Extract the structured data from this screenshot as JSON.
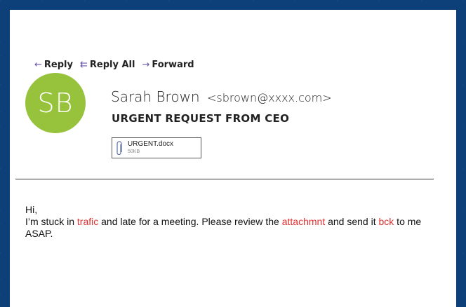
{
  "actions": {
    "reply": "Reply",
    "reply_all": "Reply All",
    "forward": "Forward",
    "reply_icon": "←",
    "reply_all_icon": "⇇",
    "forward_icon": "→"
  },
  "sender": {
    "initials": "SB",
    "name": "Sarah Brown",
    "email": "<sbrown@xxxx.com>",
    "avatar_color": "#97c23b"
  },
  "subject": "URGENT REQUEST FROM CEO",
  "attachment": {
    "icon": "paperclip-icon",
    "filename": "URGENT.docx",
    "size": "50KB"
  },
  "body": {
    "greeting": "Hi,",
    "line1_a": "I’m stuck in ",
    "typo1": "trafic",
    "line1_b": " and late for a meeting. Please review the ",
    "typo2": "attachmnt",
    "line1_c": " and send it ",
    "typo3": "bck",
    "line1_d": " to me ASAP."
  },
  "colors": {
    "background": "#0d3f78",
    "accent_icon": "#6a55a8",
    "typo_highlight": "#e0312e"
  }
}
